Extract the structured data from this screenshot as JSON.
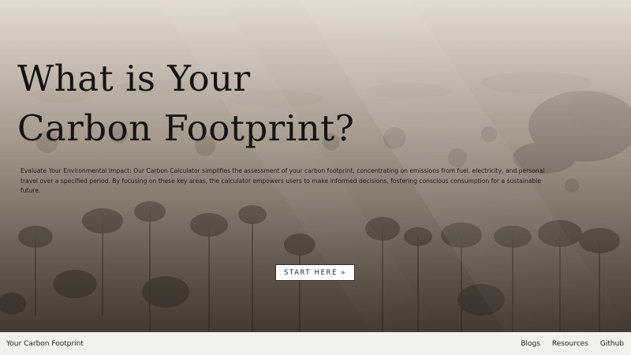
{
  "hero": {
    "title": "What is Your\nCarbon Footprint?",
    "description": "Evaluate Your Environmental Impact: Our Carbon Calculator simplifies the assessment of your carbon footprint, concentrating on emissions from fuel, electricity, and personal travel over a specified period. By focusing on these key areas, the calculator empowers users to make informed decisions, fostering conscious consumption for a sustainable future.",
    "cta_label": "START HERE »"
  },
  "footer": {
    "brand": "Your Carbon Footprint",
    "nav": [
      {
        "label": "Blogs"
      },
      {
        "label": "Resources"
      },
      {
        "label": "Github"
      }
    ]
  }
}
